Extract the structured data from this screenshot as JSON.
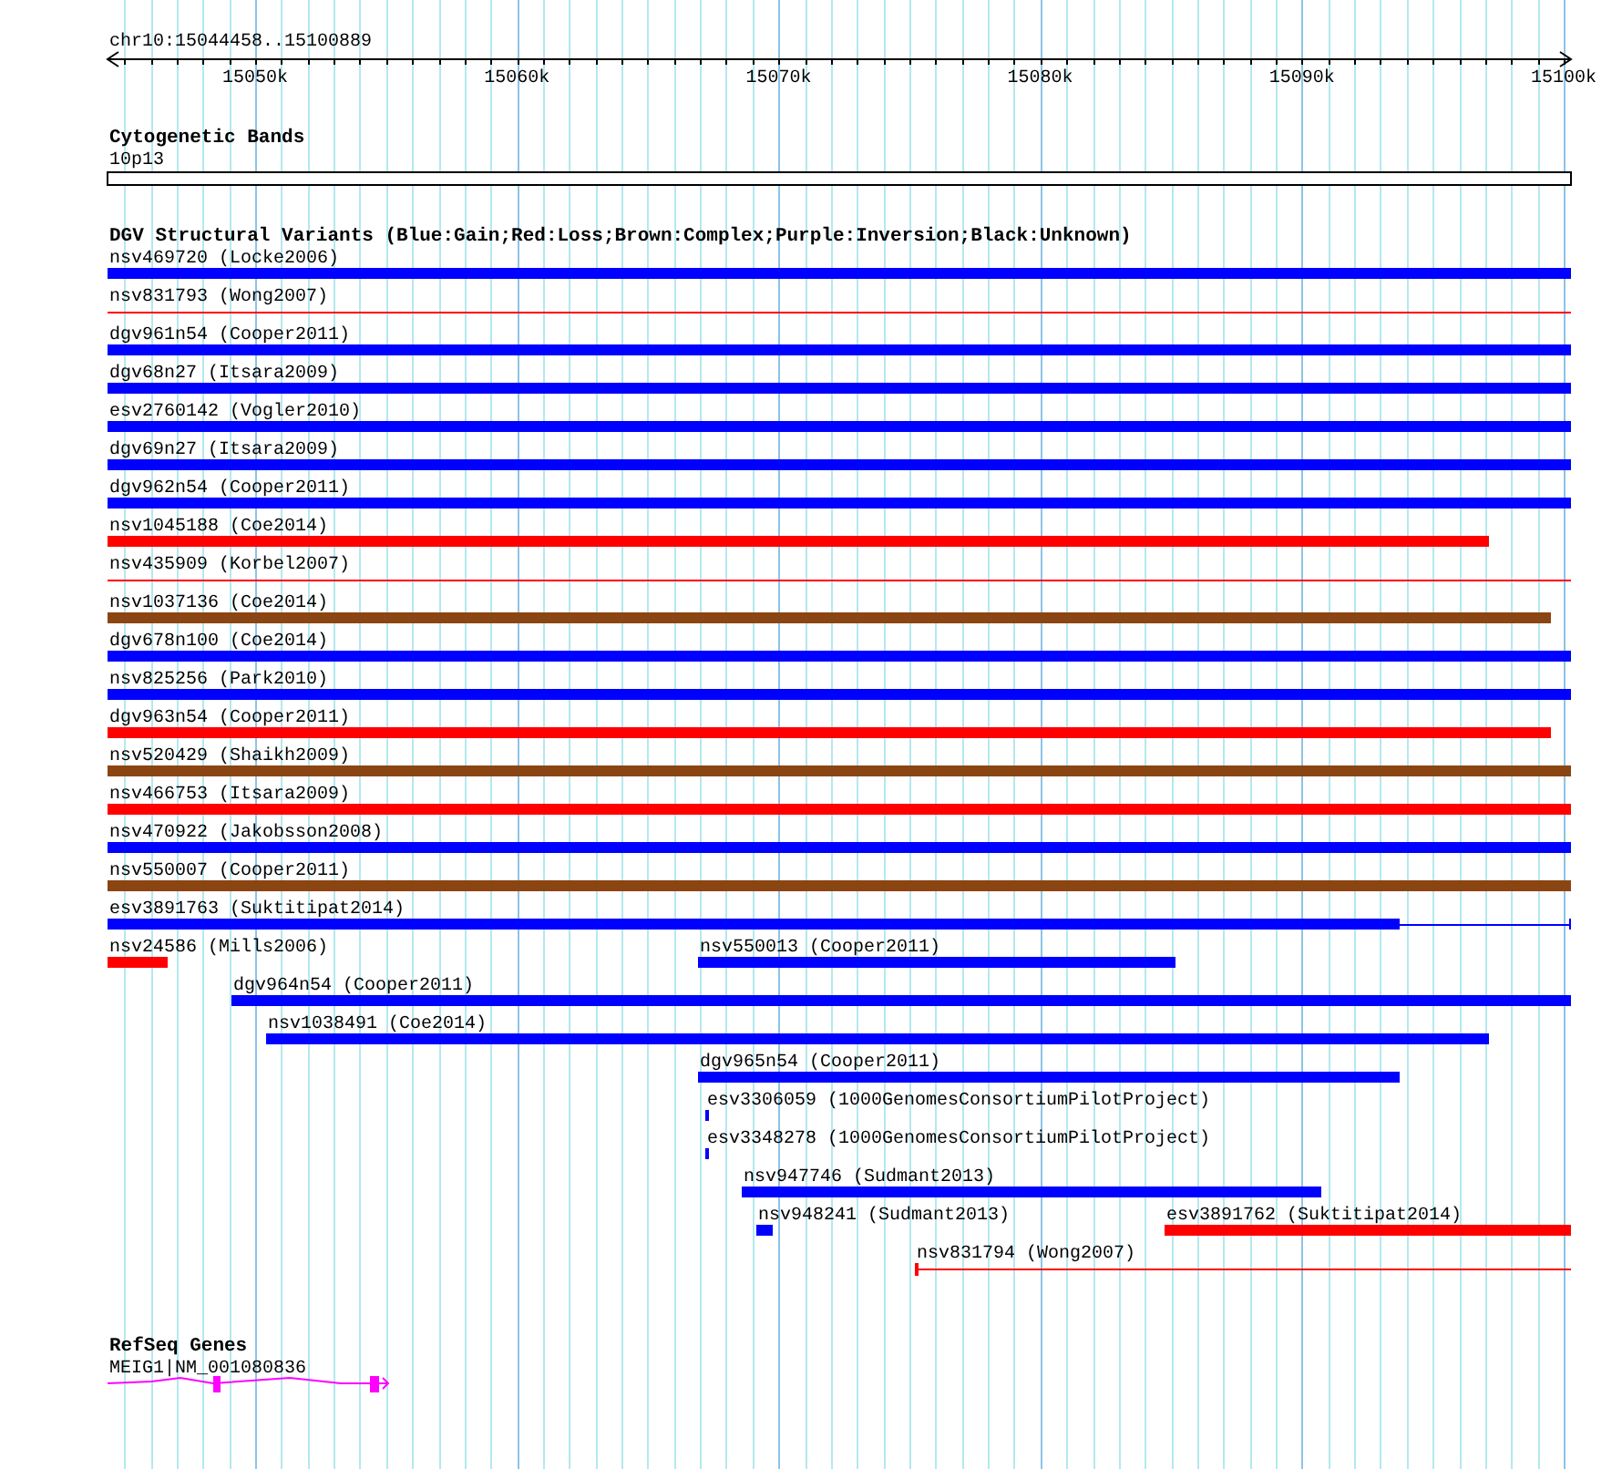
{
  "ruler": {
    "title": "chr10:15044458..15100889",
    "ticks": [
      "15050k",
      "15060k",
      "15070k",
      "15080k",
      "15090k",
      "15100k"
    ]
  },
  "cytoband_track": {
    "title": "Cytogenetic Bands",
    "bands": [
      "10p13"
    ]
  },
  "variant_track": {
    "title": "DGV Structural Variants (Blue:Gain;Red:Loss;Brown:Complex;Purple:Inversion;Black:Unknown)",
    "rows": [
      {
        "features": [
          {
            "label": "nsv469720 (Locke2006)",
            "kind": "bar",
            "color": "#0000ff"
          }
        ]
      },
      {
        "features": [
          {
            "label": "nsv831793 (Wong2007)",
            "kind": "line",
            "color": "#ff0000"
          }
        ]
      },
      {
        "features": [
          {
            "label": "dgv961n54 (Cooper2011)",
            "kind": "bar",
            "color": "#0000ff"
          }
        ]
      },
      {
        "features": [
          {
            "label": "dgv68n27 (Itsara2009)",
            "kind": "bar",
            "color": "#0000ff"
          }
        ]
      },
      {
        "features": [
          {
            "label": "esv2760142 (Vogler2010)",
            "kind": "bar",
            "color": "#0000ff"
          }
        ]
      },
      {
        "features": [
          {
            "label": "dgv69n27 (Itsara2009)",
            "kind": "bar",
            "color": "#0000ff"
          }
        ]
      },
      {
        "features": [
          {
            "label": "dgv962n54 (Cooper2011)",
            "kind": "bar",
            "color": "#0000ff"
          }
        ]
      },
      {
        "features": [
          {
            "label": "nsv1045188 (Coe2014)",
            "kind": "bar",
            "color": "#ff0000"
          }
        ]
      },
      {
        "features": [
          {
            "label": "nsv435909 (Korbel2007)",
            "kind": "line",
            "color": "#ff0000"
          }
        ]
      },
      {
        "features": [
          {
            "label": "nsv1037136 (Coe2014)",
            "kind": "bar",
            "color": "#8b4513"
          }
        ]
      },
      {
        "features": [
          {
            "label": "dgv678n100 (Coe2014)",
            "kind": "bar",
            "color": "#0000ff"
          }
        ]
      },
      {
        "features": [
          {
            "label": "nsv825256 (Park2010)",
            "kind": "bar",
            "color": "#0000ff"
          }
        ]
      },
      {
        "features": [
          {
            "label": "dgv963n54 (Cooper2011)",
            "kind": "bar",
            "color": "#ff0000"
          }
        ]
      },
      {
        "features": [
          {
            "label": "nsv520429 (Shaikh2009)",
            "kind": "bar",
            "color": "#8b4513"
          }
        ]
      },
      {
        "features": [
          {
            "label": "nsv466753 (Itsara2009)",
            "kind": "bar",
            "color": "#ff0000"
          }
        ]
      },
      {
        "features": [
          {
            "label": "nsv470922 (Jakobsson2008)",
            "kind": "bar",
            "color": "#0000ff"
          }
        ]
      },
      {
        "features": [
          {
            "label": "nsv550007 (Cooper2011)",
            "kind": "bar",
            "color": "#8b4513"
          }
        ]
      },
      {
        "features": [
          {
            "label": "esv3891763 (Suktitipat2014)",
            "kind": "bar_line",
            "color": "#0000ff"
          }
        ]
      },
      {
        "features": [
          {
            "label": "nsv24586 (Mills2006)",
            "kind": "bar",
            "color": "#ff0000"
          },
          {
            "label": "nsv550013 (Cooper2011)",
            "kind": "bar",
            "color": "#0000ff"
          }
        ]
      },
      {
        "features": [
          {
            "label": "dgv964n54 (Cooper2011)",
            "kind": "bar",
            "color": "#0000ff"
          }
        ]
      },
      {
        "features": [
          {
            "label": "nsv1038491 (Coe2014)",
            "kind": "bar",
            "color": "#0000ff"
          }
        ]
      },
      {
        "features": [
          {
            "label": "dgv965n54 (Cooper2011)",
            "kind": "bar",
            "color": "#0000ff"
          }
        ]
      },
      {
        "features": [
          {
            "label": "esv3306059 (1000GenomesConsortiumPilotProject)",
            "kind": "bar",
            "color": "#0000ff"
          }
        ]
      },
      {
        "features": [
          {
            "label": "esv3348278 (1000GenomesConsortiumPilotProject)",
            "kind": "bar",
            "color": "#0000ff"
          }
        ]
      },
      {
        "features": [
          {
            "label": "nsv947746 (Sudmant2013)",
            "kind": "bar",
            "color": "#0000ff"
          }
        ]
      },
      {
        "features": [
          {
            "label": "nsv948241 (Sudmant2013)",
            "kind": "bar",
            "color": "#0000ff"
          },
          {
            "label": "esv3891762 (Suktitipat2014)",
            "kind": "bar",
            "color": "#ff0000"
          }
        ]
      },
      {
        "features": [
          {
            "label": "nsv831794 (Wong2007)",
            "kind": "tick_line",
            "color": "#ff0000"
          }
        ]
      }
    ]
  },
  "gene_track": {
    "title": "RefSeq Genes",
    "genes": [
      "MEIG1|NM_001080836"
    ]
  }
}
